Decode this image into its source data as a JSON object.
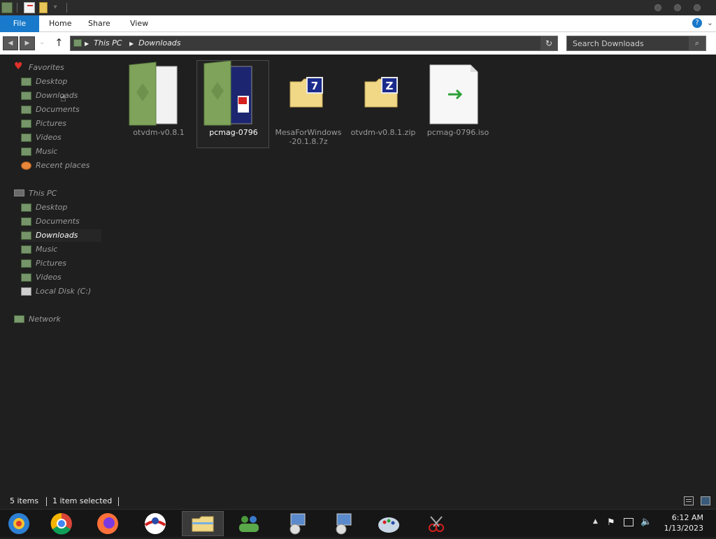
{
  "ribbon": {
    "file": "File",
    "home": "Home",
    "share": "Share",
    "view": "View",
    "help": "?"
  },
  "address": {
    "segments": [
      "This PC",
      "Downloads"
    ]
  },
  "search": {
    "placeholder": "Search Downloads"
  },
  "sidebar": {
    "favorites_label": "Favorites",
    "favorites": [
      "Desktop",
      "Downloads",
      "Documents",
      "Pictures",
      "Videos",
      "Music",
      "Recent places"
    ],
    "thispc_label": "This PC",
    "thispc": [
      "Desktop",
      "Documents",
      "Downloads",
      "Music",
      "Pictures",
      "Videos",
      "Local Disk (C:)"
    ],
    "network_label": "Network"
  },
  "files": [
    {
      "name": "otvdm-v0.8.1",
      "icon": "folder-icon"
    },
    {
      "name": "pcmag-0796",
      "icon": "folder-icon",
      "selected": true
    },
    {
      "name": "MesaForWindows-20.1.8.7z",
      "icon": "7z-archive-icon"
    },
    {
      "name": "otvdm-v0.8.1.zip",
      "icon": "zip-archive-icon"
    },
    {
      "name": "pcmag-0796.iso",
      "icon": "iso-file-icon"
    }
  ],
  "status": {
    "count": "5 items",
    "selected": "1 item selected"
  },
  "clock": {
    "time": "6:12 AM",
    "date": "1/13/2023"
  },
  "colors": {
    "accent": "#1979ca",
    "background": "#1f1f1f"
  }
}
